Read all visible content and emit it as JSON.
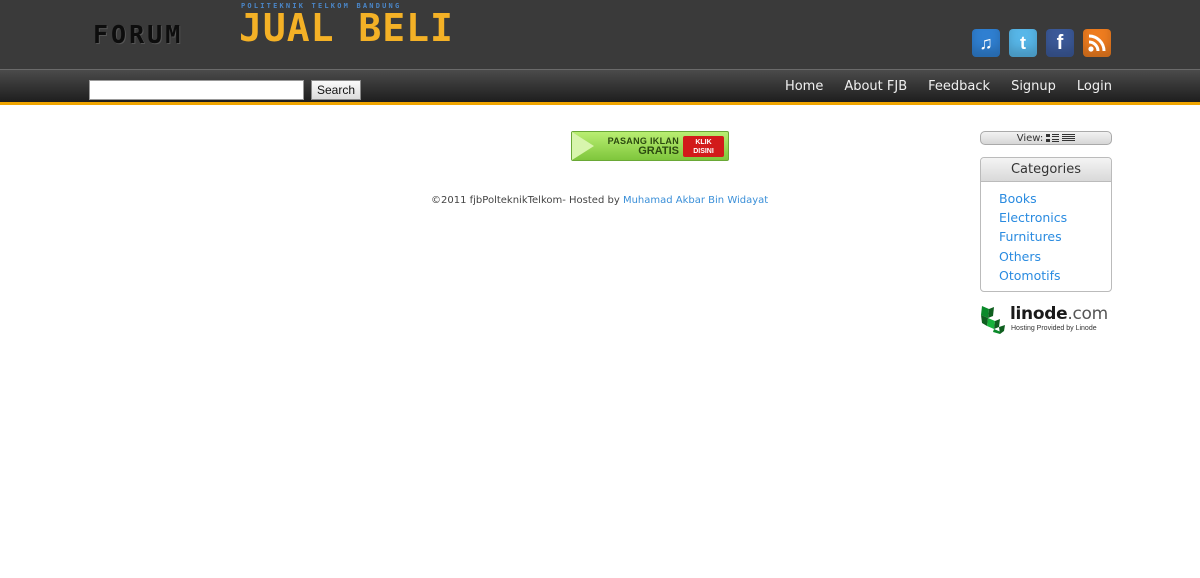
{
  "header": {
    "logo": {
      "tagline": "POLITEKNIK TELKOM BANDUNG",
      "forum": "FORUM",
      "jual_beli": "JUAL BELI"
    },
    "social_icons": [
      {
        "name": "itunes-icon",
        "glyph": "♫"
      },
      {
        "name": "twitter-icon",
        "glyph": "t"
      },
      {
        "name": "facebook-icon",
        "glyph": "f"
      },
      {
        "name": "rss-icon",
        "glyph": "rss"
      }
    ]
  },
  "nav": {
    "search": {
      "value": "",
      "placeholder": "",
      "button_label": "Search"
    },
    "links": [
      "Home",
      "About FJB",
      "Feedback",
      "Signup",
      "Login"
    ]
  },
  "banner": {
    "line1": "PASANG IKLAN",
    "line2": "GRATIS",
    "cta_line1": "KLIK",
    "cta_line2": "DISINI"
  },
  "footer": {
    "text": "©2011 fjbPolteknikTelkom- Hosted by",
    "author_link": "Muhamad Akbar Bin Widayat"
  },
  "sidebar": {
    "view_label": "View:",
    "categories_title": "Categories",
    "categories": [
      "Books",
      "Electronics",
      "Furnitures",
      "Others",
      "Otomotifs"
    ],
    "sponsor": {
      "name": "linode",
      "tld": ".com",
      "subtitle": "Hosting Provided by Linode"
    }
  },
  "colors": {
    "header_bg": "#3a3a3a",
    "accent_orange": "#f0a500",
    "logo_yellow": "#f4b126",
    "link_blue": "#2a8be0",
    "banner_green": "#8fd14b"
  }
}
